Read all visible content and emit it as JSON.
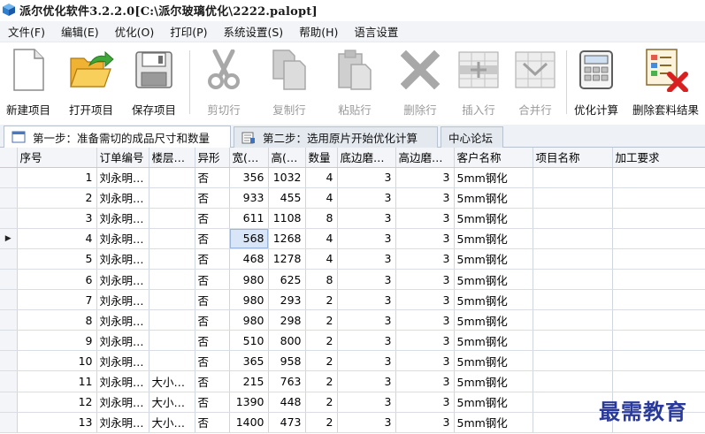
{
  "window": {
    "title": "派尔优化软件3.2.2.0[C:\\派尔玻璃优化\\2222.palopt]",
    "app_icon": "cube-app-icon"
  },
  "menu": [
    {
      "label": "文件(F)"
    },
    {
      "label": "编辑(E)"
    },
    {
      "label": "优化(O)"
    },
    {
      "label": "打印(P)"
    },
    {
      "label": "系统设置(S)"
    },
    {
      "label": "帮助(H)"
    },
    {
      "label": "语言设置"
    }
  ],
  "toolbar": {
    "new_project": "新建项目",
    "open_project": "打开项目",
    "save_project": "保存项目",
    "cut_row": "剪切行",
    "copy_row": "复制行",
    "paste_row": "粘贴行",
    "delete_row": "删除行",
    "insert_row": "插入行",
    "merge_row": "合并行",
    "optimize_calc": "优化计算",
    "delete_cutting_result": "删除套料结果"
  },
  "tabs": [
    {
      "label": "第一步：准备需切的成品尺寸和数量",
      "active": true
    },
    {
      "label": "第二步：选用原片开始优化计算",
      "active": false
    },
    {
      "label": "中心论坛",
      "active": false
    }
  ],
  "table": {
    "columns": [
      "序号",
      "订单编号",
      "楼层…",
      "异形",
      "宽(…",
      "高(…",
      "数量",
      "底边磨…",
      "高边磨…",
      "客户名称",
      "项目名称",
      "加工要求"
    ],
    "current_row_index": 3,
    "rows": [
      [
        "1",
        "刘永明…",
        "",
        "否",
        "356",
        "1032",
        "4",
        "3",
        "3",
        "5mm钢化",
        "",
        ""
      ],
      [
        "2",
        "刘永明…",
        "",
        "否",
        "933",
        "455",
        "4",
        "3",
        "3",
        "5mm钢化",
        "",
        ""
      ],
      [
        "3",
        "刘永明…",
        "",
        "否",
        "611",
        "1108",
        "8",
        "3",
        "3",
        "5mm钢化",
        "",
        ""
      ],
      [
        "4",
        "刘永明…",
        "",
        "否",
        "568",
        "1268",
        "4",
        "3",
        "3",
        "5mm钢化",
        "",
        ""
      ],
      [
        "5",
        "刘永明…",
        "",
        "否",
        "468",
        "1278",
        "4",
        "3",
        "3",
        "5mm钢化",
        "",
        ""
      ],
      [
        "6",
        "刘永明…",
        "",
        "否",
        "980",
        "625",
        "8",
        "3",
        "3",
        "5mm钢化",
        "",
        ""
      ],
      [
        "7",
        "刘永明…",
        "",
        "否",
        "980",
        "293",
        "2",
        "3",
        "3",
        "5mm钢化",
        "",
        ""
      ],
      [
        "8",
        "刘永明…",
        "",
        "否",
        "980",
        "298",
        "2",
        "3",
        "3",
        "5mm钢化",
        "",
        ""
      ],
      [
        "9",
        "刘永明…",
        "",
        "否",
        "510",
        "800",
        "2",
        "3",
        "3",
        "5mm钢化",
        "",
        ""
      ],
      [
        "10",
        "刘永明…",
        "",
        "否",
        "365",
        "958",
        "2",
        "3",
        "3",
        "5mm钢化",
        "",
        ""
      ],
      [
        "11",
        "刘永明…",
        "大小…",
        "否",
        "215",
        "763",
        "2",
        "3",
        "3",
        "5mm钢化",
        "",
        ""
      ],
      [
        "12",
        "刘永明…",
        "大小…",
        "否",
        "1390",
        "448",
        "2",
        "3",
        "3",
        "5mm钢化",
        "",
        ""
      ],
      [
        "13",
        "刘永明…",
        "大小…",
        "否",
        "1400",
        "473",
        "2",
        "3",
        "3",
        "5mm钢化",
        "",
        ""
      ]
    ]
  },
  "watermark": "最需教育"
}
